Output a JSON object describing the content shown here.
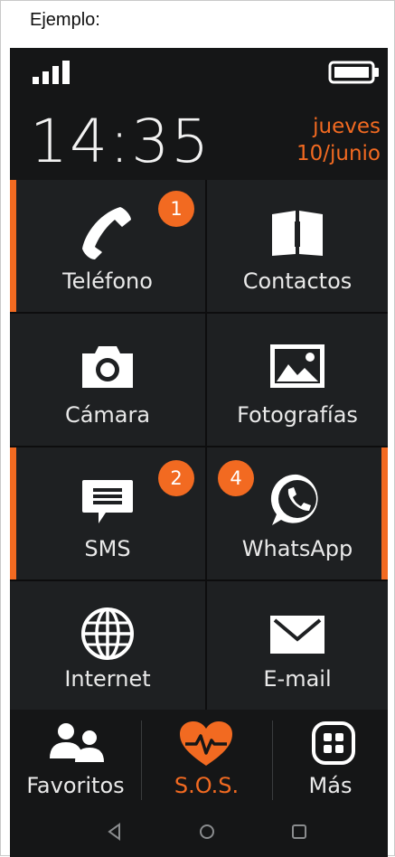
{
  "caption": "Ejemplo:",
  "status": {
    "icons": [
      "signal-icon",
      "battery-icon"
    ]
  },
  "clock": {
    "time": "14:35",
    "day": "jueves",
    "date": "10/junio"
  },
  "tiles": [
    {
      "label": "Teléfono",
      "icon": "phone-icon",
      "badge": "1"
    },
    {
      "label": "Contactos",
      "icon": "contacts-book-icon"
    },
    {
      "label": "Cámara",
      "icon": "camera-icon"
    },
    {
      "label": "Fotografías",
      "icon": "photos-icon"
    },
    {
      "label": "SMS",
      "icon": "sms-icon",
      "badge": "2"
    },
    {
      "label": "WhatsApp",
      "icon": "whatsapp-icon",
      "badge": "4"
    },
    {
      "label": "Internet",
      "icon": "globe-icon"
    },
    {
      "label": "E-mail",
      "icon": "mail-icon"
    }
  ],
  "bottom": [
    {
      "label": "Favoritos",
      "icon": "favorites-people-icon"
    },
    {
      "label": "S.O.S.",
      "icon": "sos-heart-icon"
    },
    {
      "label": "Más",
      "icon": "more-grid-icon"
    }
  ],
  "nav": [
    "back-icon",
    "home-icon",
    "recents-icon"
  ],
  "colors": {
    "accent": "#f26a21",
    "background": "#151617",
    "tile": "#1e2022",
    "text": "#e9e9e9"
  }
}
